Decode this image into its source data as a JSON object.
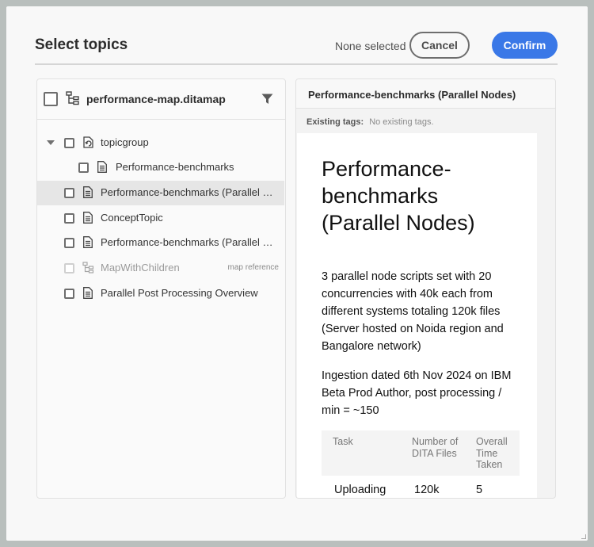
{
  "dialog": {
    "title": "Select topics",
    "selection_status": "None selected",
    "cancel_label": "Cancel",
    "confirm_label": "Confirm",
    "accent_color": "#3a78e7"
  },
  "left": {
    "map_name": "performance-map.ditamap",
    "items": [
      {
        "label": "topicgroup",
        "icon": "topicgroup-icon"
      },
      {
        "label": "Performance-benchmarks",
        "icon": "document-icon"
      },
      {
        "label": "Performance-benchmarks (Parallel Nodes)",
        "icon": "document-icon"
      },
      {
        "label": "ConceptTopic",
        "icon": "document-icon"
      },
      {
        "label": "Performance-benchmarks (Parallel Nodes)",
        "icon": "document-icon"
      },
      {
        "label": "MapWithChildren",
        "icon": "map-icon",
        "badge": "map reference"
      },
      {
        "label": "Parallel Post Processing Overview",
        "icon": "document-icon"
      }
    ]
  },
  "right": {
    "title": "Performance-benchmarks (Parallel Nodes)",
    "tags_label": "Existing tags:",
    "tags_value": "No existing tags.",
    "preview": {
      "heading": "Performance-benchmarks (Parallel Nodes)",
      "paragraph1": "3 parallel node scripts set with 20 concurrencies with 40k each from different systems totaling 120k files (Server hosted on Noida region and Bangalore network)",
      "paragraph2": "Ingestion dated 6th Nov 2024 on IBM Beta Prod Author, post processing / min = ~150",
      "table": {
        "headers": [
          "Task",
          "Number of DITA Files",
          "Overall Time Taken"
        ],
        "rows": [
          [
            "Uploading",
            "120k",
            "5"
          ]
        ]
      }
    }
  }
}
